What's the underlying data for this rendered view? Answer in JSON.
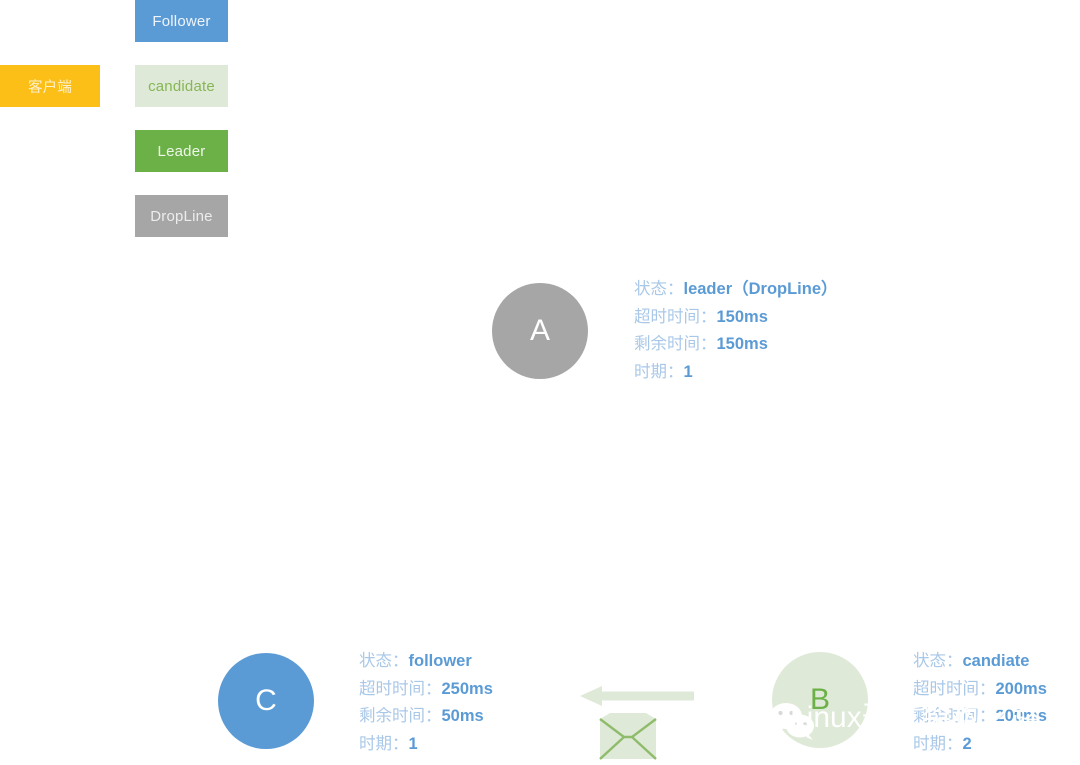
{
  "legend": {
    "items": [
      {
        "key": "client",
        "label": "客户端",
        "bg": "#fcbf17",
        "fg": "#fdf0cc"
      },
      {
        "key": "follower",
        "label": "Follower",
        "bg": "#5b9bd5",
        "fg": "#eef4fb"
      },
      {
        "key": "candidate",
        "label": "candidate",
        "bg": "#dfe9d8",
        "fg": "#86b655"
      },
      {
        "key": "leader",
        "label": "Leader",
        "bg": "#6bb148",
        "fg": "#eef6e8"
      },
      {
        "key": "dropline",
        "label": "DropLine",
        "bg": "#a6a6a6",
        "fg": "#ececec"
      }
    ]
  },
  "nodes": {
    "a": {
      "id": "A",
      "color": "#a6a6a6",
      "info": [
        {
          "label": "状态：",
          "value": "leader（DropLine）"
        },
        {
          "label": "超时时间：",
          "value": "150ms"
        },
        {
          "label": "剩余时间：",
          "value": "150ms"
        },
        {
          "label": "时期：",
          "value": "1"
        }
      ]
    },
    "c": {
      "id": "C",
      "color": "#5b9bd5",
      "info": [
        {
          "label": "状态：",
          "value": "follower"
        },
        {
          "label": "超时时间：",
          "value": "250ms"
        },
        {
          "label": "剩余时间：",
          "value": "50ms"
        },
        {
          "label": "时期：",
          "value": "1"
        }
      ]
    },
    "b": {
      "id": "B",
      "color": "#dfe9d8",
      "info": [
        {
          "label": "状态：",
          "value": "candiate"
        },
        {
          "label": "超时时间：",
          "value": "200ms"
        },
        {
          "label": "剩余时间：",
          "value": "200ms"
        },
        {
          "label": "时期：",
          "value": "2"
        }
      ]
    }
  },
  "message": {
    "direction": "left",
    "icon": "envelope-icon",
    "color": "#dfe9d8",
    "stroke": "#8fbc6b"
  },
  "watermark": {
    "text": "Linux开发架构之路",
    "logo": "wechat-icon"
  },
  "colors": {
    "label_text": "#a9c8e8",
    "value_text": "#5b9bd5",
    "background": "#ffffff"
  }
}
